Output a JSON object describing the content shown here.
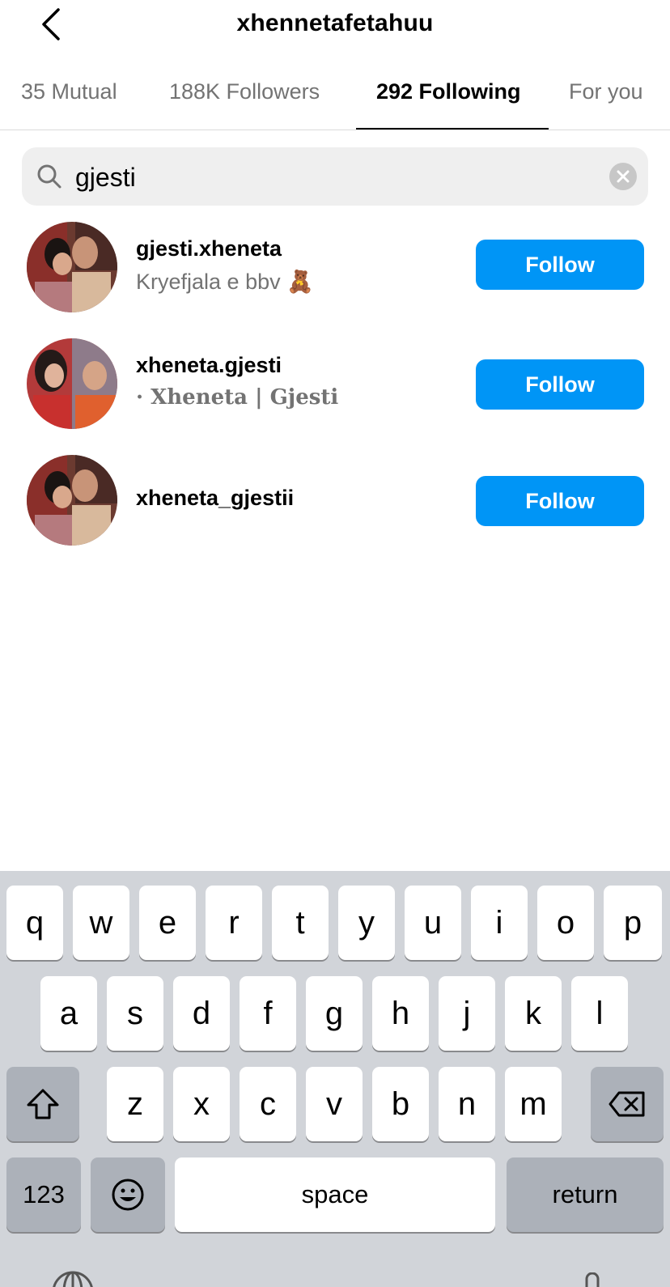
{
  "header": {
    "title": "xhennetafetahuu",
    "back_icon": "chevron-left-icon"
  },
  "tabs": [
    {
      "label": "35 Mutual",
      "active": false
    },
    {
      "label": "188K Followers",
      "active": false
    },
    {
      "label": "292 Following",
      "active": true
    },
    {
      "label": "For you",
      "active": false
    }
  ],
  "search": {
    "value": "gjesti",
    "icon": "search-icon",
    "clear_icon": "clear-icon"
  },
  "results": [
    {
      "username": "gjesti.xheneta",
      "subtitle": "Kryefjala e bbv 🧸",
      "button": "Follow"
    },
    {
      "username": "xheneta.gjesti",
      "subtitle": "· Xheneta | Gjesti",
      "button": "Follow"
    },
    {
      "username": "xheneta_gjestii",
      "subtitle": "",
      "button": "Follow"
    }
  ],
  "keyboard": {
    "row1": [
      "q",
      "w",
      "e",
      "r",
      "t",
      "y",
      "u",
      "i",
      "o",
      "p"
    ],
    "row2": [
      "a",
      "s",
      "d",
      "f",
      "g",
      "h",
      "j",
      "k",
      "l"
    ],
    "row3": [
      "z",
      "x",
      "c",
      "v",
      "b",
      "n",
      "m"
    ],
    "numbers_label": "123",
    "space_label": "space",
    "return_label": "return",
    "shift_icon": "shift-icon",
    "delete_icon": "delete-icon",
    "emoji_icon": "emoji-icon",
    "globe_icon": "globe-icon",
    "mic_icon": "microphone-icon"
  },
  "colors": {
    "follow_button": "#0095f6",
    "keyboard_bg": "#d1d4d9",
    "muted_text": "#737373"
  }
}
